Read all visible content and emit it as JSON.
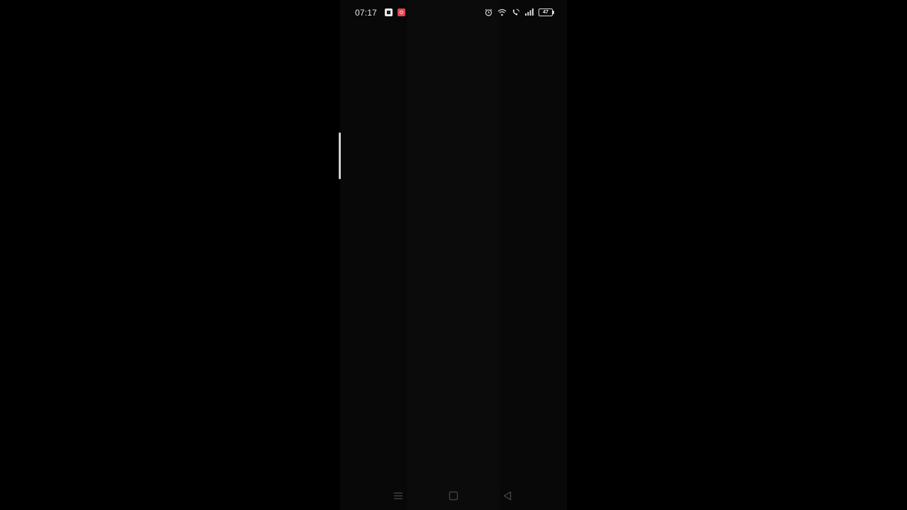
{
  "status_bar": {
    "time": "07:17",
    "notification_icons": [
      "app-notification-icon",
      "camera-app-icon"
    ],
    "system_icons": [
      "alarm-icon",
      "wifi-icon",
      "wifi-calling-icon",
      "signal-icon"
    ],
    "battery": "47"
  },
  "nav_bar": {
    "buttons": [
      "recent-apps",
      "home",
      "back"
    ]
  },
  "colors": {
    "background": "#000000",
    "screen": "#080808",
    "status_text": "#e6e6e6",
    "camera_badge": "#e0444f"
  }
}
